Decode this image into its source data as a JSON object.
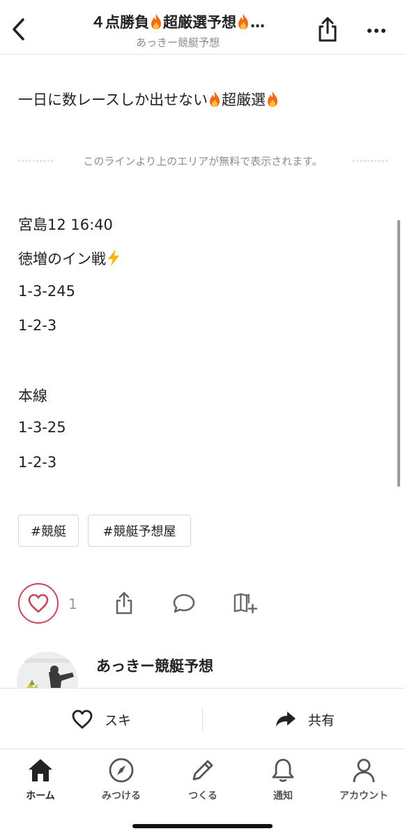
{
  "header": {
    "title_prefix": "４点勝負",
    "title_middle": "超厳選予想",
    "title_suffix": "…",
    "subtitle": "あっきー競艇予想"
  },
  "article": {
    "lead_text": "一日に数レースしか出せない",
    "lead_suffix": "超厳選",
    "paywall_notice": "このラインより上のエリアが無料で表示されます。",
    "race": "宮島12 16:40",
    "comment": "徳増のイン戦",
    "pick_1": "1-3-245",
    "pick_2": "1-2-3",
    "main_label": "本線",
    "main_1": "1-3-25",
    "main_2": "1-2-3",
    "tags": [
      "#競艇",
      "#競艇予想屋"
    ]
  },
  "actions": {
    "like_count": "1"
  },
  "author": {
    "name": "あっきー競艇予想"
  },
  "bottom_bar": {
    "like_label": "スキ",
    "share_label": "共有"
  },
  "tabbar": {
    "items": [
      {
        "label": "ホーム",
        "icon": "home-icon"
      },
      {
        "label": "みつける",
        "icon": "compass-icon"
      },
      {
        "label": "つくる",
        "icon": "pencil-icon"
      },
      {
        "label": "通知",
        "icon": "bell-icon"
      },
      {
        "label": "アカウント",
        "icon": "person-icon"
      }
    ]
  },
  "colors": {
    "like_accent": "#c8465a",
    "flame": "#f26b1d",
    "lightning": "#f5b400"
  }
}
